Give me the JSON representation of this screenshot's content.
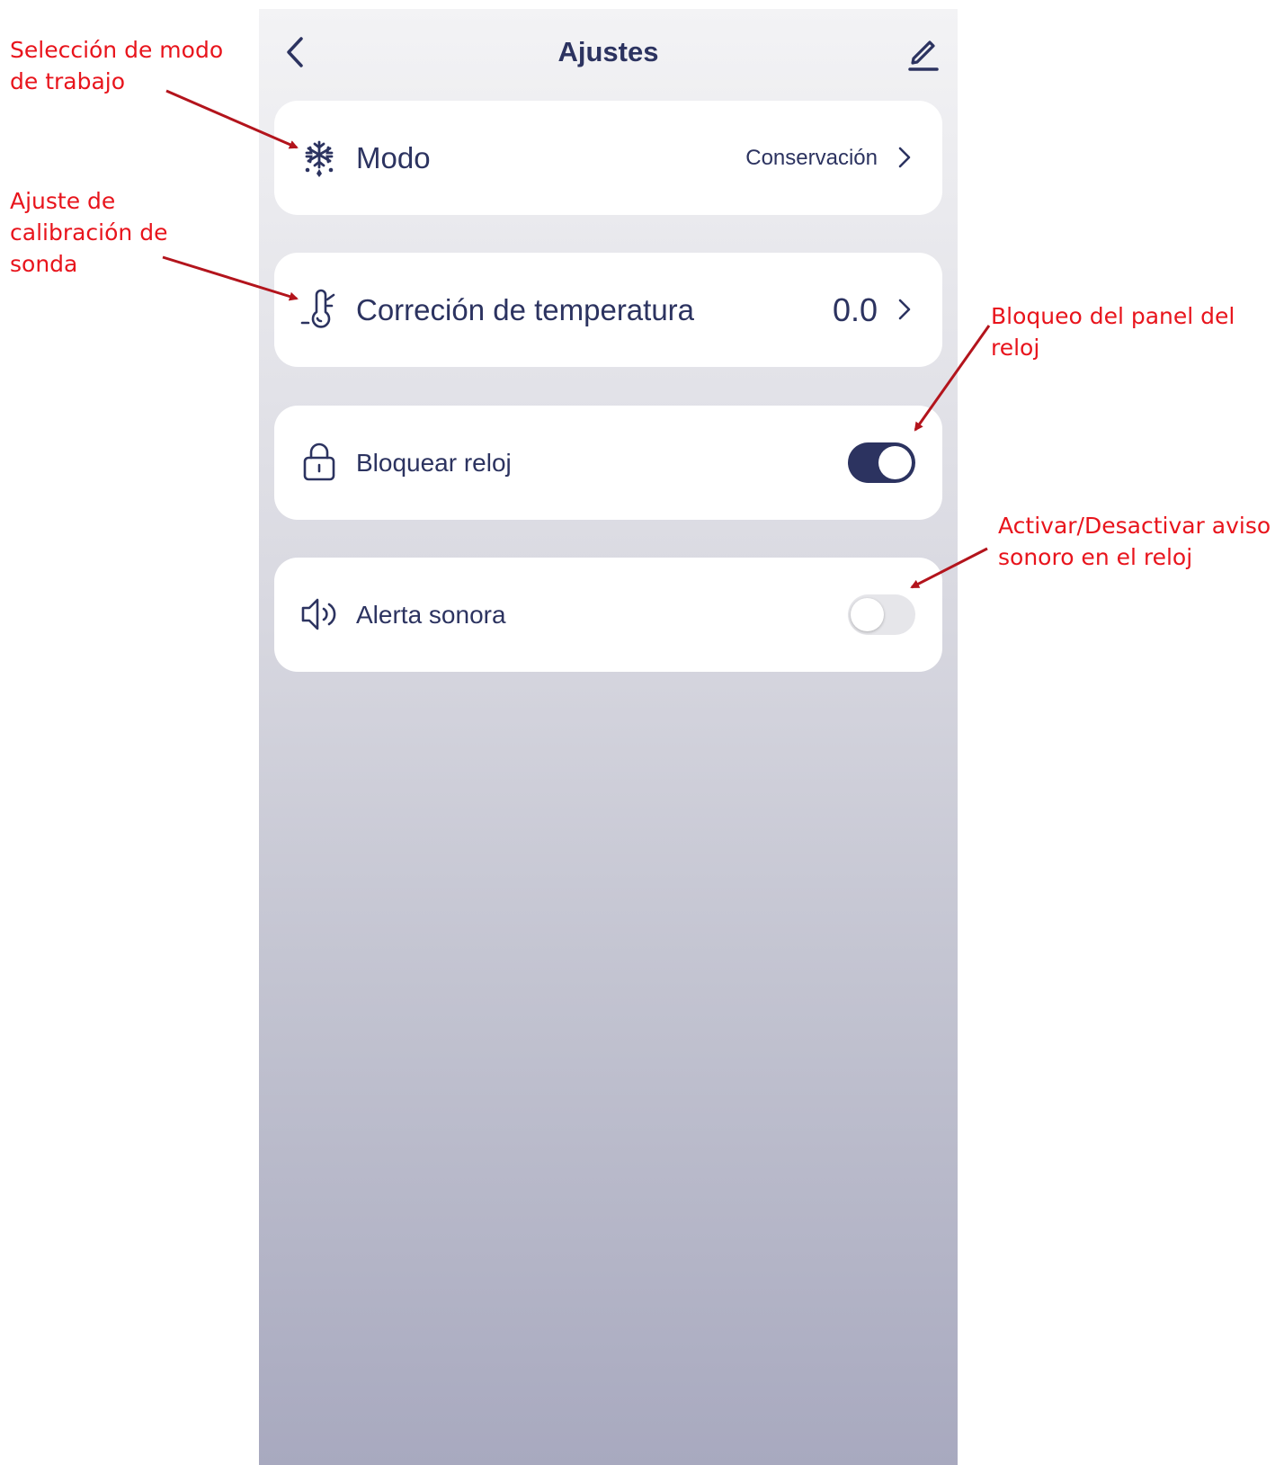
{
  "header": {
    "title": "Ajustes",
    "back_icon": "chevron-left-icon",
    "edit_icon": "pencil-icon"
  },
  "settings": {
    "mode": {
      "label": "Modo",
      "value": "Conservación",
      "icon": "snowflake-icon"
    },
    "temperature_correction": {
      "label": "Correción de temperatura",
      "value": "0.0",
      "icon": "thermometer-icon"
    },
    "lock_clock": {
      "label": "Bloquear reloj",
      "enabled": true,
      "icon": "lock-icon"
    },
    "sound_alert": {
      "label": "Alerta sonora",
      "enabled": false,
      "icon": "speaker-icon"
    }
  },
  "annotations": {
    "mode": "Selección de modo\nde trabajo",
    "calibration": "Ajuste de\ncalibración de\nsonda",
    "lock": "Bloqueo del panel del\nreloj",
    "sound": "Activar/Desactivar aviso\nsonoro en el reloj"
  },
  "colors": {
    "primary": "#2c3360",
    "annotation": "#e8141c",
    "arrow": "#b3141c",
    "toggle_off": "#e6e6ea"
  }
}
